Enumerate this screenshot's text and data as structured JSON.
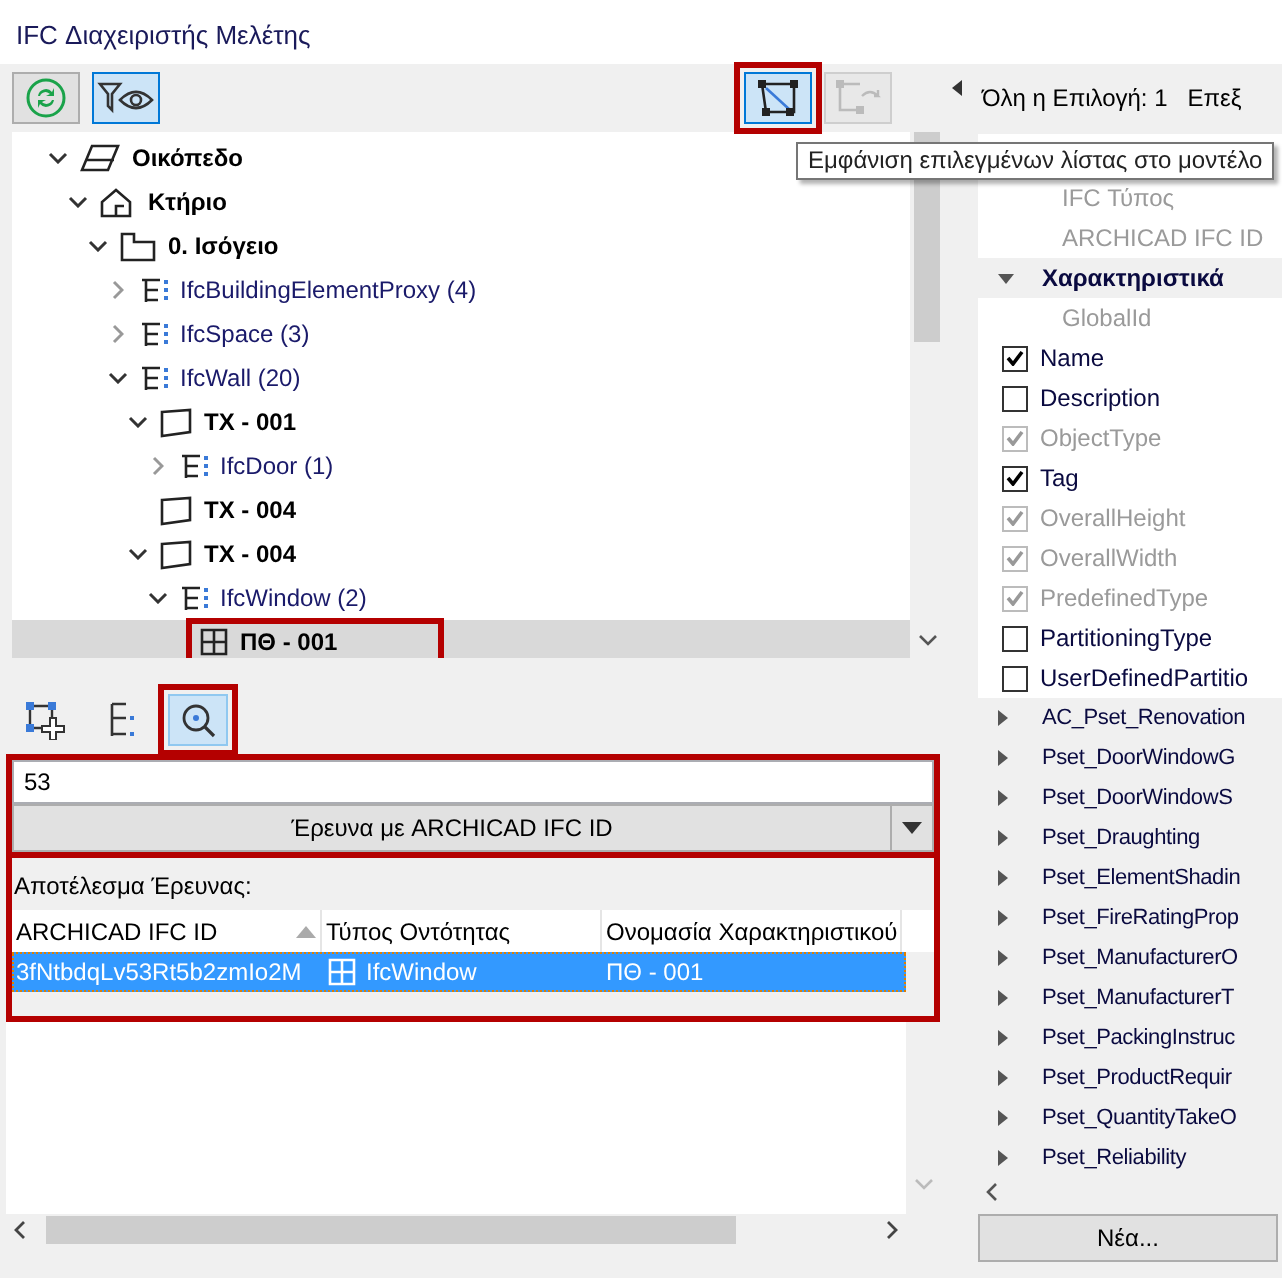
{
  "window": {
    "title": "IFC Διαχειριστής Μελέτης"
  },
  "toolbar": {
    "buttons": [
      {
        "kind": "refresh",
        "selected": false,
        "disabled": false
      },
      {
        "kind": "filter-eye",
        "selected": true,
        "disabled": false
      },
      {
        "kind": "show-in-model",
        "selected": true,
        "disabled": false,
        "highlighted": true
      },
      {
        "kind": "show-linked",
        "selected": false,
        "disabled": true
      }
    ]
  },
  "tooltip": "Εμφάνιση επιλεγμένων λίστας στο μοντέλο",
  "tree": [
    {
      "label": "Οικόπεδο",
      "kind": "site",
      "expanded": true,
      "selected": false,
      "children": [
        {
          "label": "Κτήριο",
          "kind": "building",
          "expanded": true,
          "selected": false,
          "children": [
            {
              "label": "0. Ισόγειο",
              "kind": "storey",
              "expanded": true,
              "selected": false,
              "children": [
                {
                  "label": "IfcBuildingElementProxy (4)",
                  "kind": "class",
                  "expanded": false,
                  "selected": false
                },
                {
                  "label": "IfcSpace (3)",
                  "kind": "class",
                  "expanded": false,
                  "selected": false
                },
                {
                  "label": "IfcWall (20)",
                  "kind": "class",
                  "expanded": true,
                  "selected": false,
                  "children": [
                    {
                      "label": "ΤΧ - 001",
                      "kind": "element",
                      "expanded": true,
                      "selected": false,
                      "children": [
                        {
                          "label": "IfcDoor (1)",
                          "kind": "class",
                          "expanded": false,
                          "selected": false
                        }
                      ]
                    },
                    {
                      "label": "ΤΧ - 004",
                      "kind": "element",
                      "selected": false
                    },
                    {
                      "label": "ΤΧ - 004",
                      "kind": "element",
                      "expanded": true,
                      "selected": false,
                      "children": [
                        {
                          "label": "IfcWindow (2)",
                          "kind": "class",
                          "expanded": true,
                          "selected": false,
                          "children": [
                            {
                              "label": "ΠΘ - 001",
                              "kind": "window",
                              "selected": true,
                              "highlighted": true
                            }
                          ]
                        }
                      ]
                    }
                  ]
                }
              ]
            }
          ]
        }
      ]
    }
  ],
  "mode_buttons": [
    {
      "kind": "add-selection",
      "selected": false
    },
    {
      "kind": "tree-view",
      "selected": false
    },
    {
      "kind": "search",
      "selected": true,
      "highlighted": true
    }
  ],
  "search": {
    "value": "53",
    "button": "Έρευνα με ARCHICAD IFC ID",
    "highlighted": true
  },
  "results": {
    "label": "Αποτέλεσμα Έρευνας:",
    "highlighted": true,
    "columns": [
      {
        "label": "ARCHICAD IFC ID",
        "sorted": true
      },
      {
        "label": "Τύπος Οντότητας"
      },
      {
        "label": "Ονομασία Χαρακτηριστικού"
      }
    ],
    "rows": [
      {
        "cells": [
          "3fNtbdqLv53Rt5b2zmIo2M",
          "IfcWindow",
          "ΠΘ - 001"
        ],
        "selected": true
      }
    ]
  },
  "properties": {
    "selection_label": "Όλη η Επιλογή: 1",
    "edit_label": "Επεξ",
    "items": [
      {
        "kind": "field",
        "label": "IFC Τύπος"
      },
      {
        "kind": "field",
        "label": "ARCHICAD IFC ID"
      },
      {
        "kind": "group",
        "label": "Χαρακτηριστικά",
        "expanded": true
      },
      {
        "kind": "field",
        "label": "GlobalId"
      },
      {
        "kind": "check",
        "label": "Name",
        "checked": true,
        "disabled": false
      },
      {
        "kind": "check",
        "label": "Description",
        "checked": false,
        "disabled": false
      },
      {
        "kind": "check",
        "label": "ObjectType",
        "checked": true,
        "disabled": true
      },
      {
        "kind": "check",
        "label": "Tag",
        "checked": true,
        "disabled": false
      },
      {
        "kind": "check",
        "label": "OverallHeight",
        "checked": true,
        "disabled": true
      },
      {
        "kind": "check",
        "label": "OverallWidth",
        "checked": true,
        "disabled": true
      },
      {
        "kind": "check",
        "label": "PredefinedType",
        "checked": true,
        "disabled": true
      },
      {
        "kind": "check",
        "label": "PartitioningType",
        "checked": false,
        "disabled": false
      },
      {
        "kind": "check",
        "label": "UserDefinedPartitio",
        "checked": false,
        "disabled": false
      },
      {
        "kind": "group",
        "label": "AC_Pset_Renovation",
        "expanded": false
      },
      {
        "kind": "group",
        "label": "Pset_DoorWindowG",
        "expanded": false
      },
      {
        "kind": "group",
        "label": "Pset_DoorWindowS",
        "expanded": false
      },
      {
        "kind": "group",
        "label": "Pset_Draughting",
        "expanded": false
      },
      {
        "kind": "group",
        "label": "Pset_ElementShadin",
        "expanded": false
      },
      {
        "kind": "group",
        "label": "Pset_FireRatingProp",
        "expanded": false
      },
      {
        "kind": "group",
        "label": "Pset_ManufacturerO",
        "expanded": false
      },
      {
        "kind": "group",
        "label": "Pset_ManufacturerT",
        "expanded": false
      },
      {
        "kind": "group",
        "label": "Pset_PackingInstruc",
        "expanded": false
      },
      {
        "kind": "group",
        "label": "Pset_ProductRequir",
        "expanded": false
      },
      {
        "kind": "group",
        "label": "Pset_QuantityTakeO",
        "expanded": false
      },
      {
        "kind": "group",
        "label": "Pset_Reliability",
        "expanded": false
      }
    ],
    "new_button": "Νέα..."
  }
}
